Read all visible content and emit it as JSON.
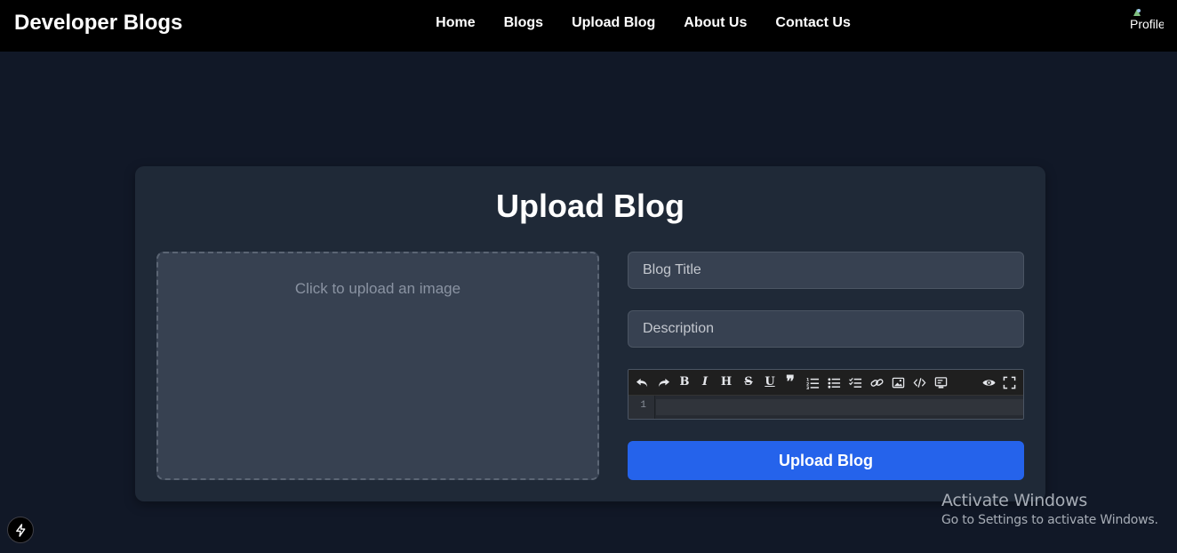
{
  "header": {
    "brand": "Developer Blogs",
    "nav": [
      "Home",
      "Blogs",
      "Upload Blog",
      "About Us",
      "Contact Us"
    ],
    "profile_alt": "Profile"
  },
  "card": {
    "title": "Upload Blog",
    "dropzone_text": "Click to upload an image",
    "title_placeholder": "Blog Title",
    "description_placeholder": "Description",
    "editor": {
      "toolbar_icons": [
        "undo-icon",
        "redo-icon",
        "bold-icon",
        "italic-icon",
        "heading-icon",
        "strikethrough-icon",
        "underline-icon",
        "quote-icon",
        "ordered-list-icon",
        "unordered-list-icon",
        "checklist-icon",
        "link-icon",
        "image-icon",
        "code-icon",
        "code-block-icon",
        "preview-icon",
        "fullscreen-icon"
      ],
      "line_number": "1"
    },
    "submit_label": "Upload Blog"
  },
  "watermark": {
    "title": "Activate Windows",
    "subtitle": "Go to Settings to activate Windows."
  },
  "colors": {
    "page_bg": "#111827",
    "card_bg": "#1f2937",
    "input_bg": "#374151",
    "accent": "#2563eb",
    "nav_bg": "#000000"
  }
}
